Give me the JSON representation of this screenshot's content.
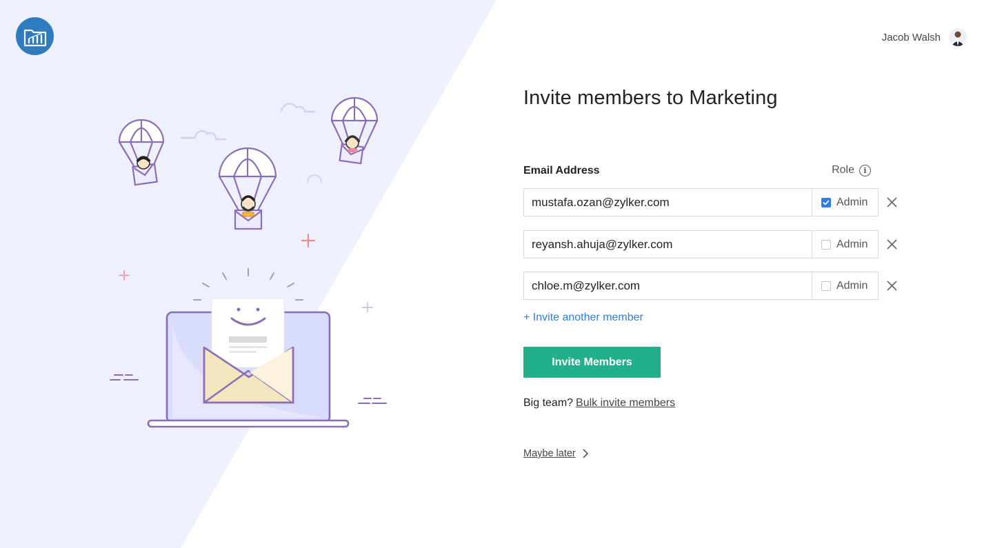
{
  "header": {
    "logo_icon": "folder-chart-icon",
    "user_name": "Jacob Walsh",
    "avatar_icon": "user-avatar"
  },
  "main": {
    "title": "Invite members to Marketing",
    "columns": {
      "email": "Email Address",
      "role": "Role"
    },
    "role_info_icon": "info-icon",
    "invites": [
      {
        "email": "mustafa.ozan@zylker.com",
        "role_label": "Admin",
        "admin": true
      },
      {
        "email": "reyansh.ahuja@zylker.com",
        "role_label": "Admin",
        "admin": false
      },
      {
        "email": "chloe.m@zylker.com",
        "role_label": "Admin",
        "admin": false
      }
    ],
    "invite_another_label": "+ Invite another member",
    "invite_button_label": "Invite Members",
    "bulk_prefix": "Big team?",
    "bulk_link_label": "Bulk invite members",
    "maybe_later_label": "Maybe later"
  },
  "colors": {
    "accent_green": "#22b08a",
    "link_blue": "#2f7de1",
    "logo_blue": "#2f7bc0",
    "panel_lavender": "#eef0fd",
    "illustration_purple": "#8a6db5"
  }
}
